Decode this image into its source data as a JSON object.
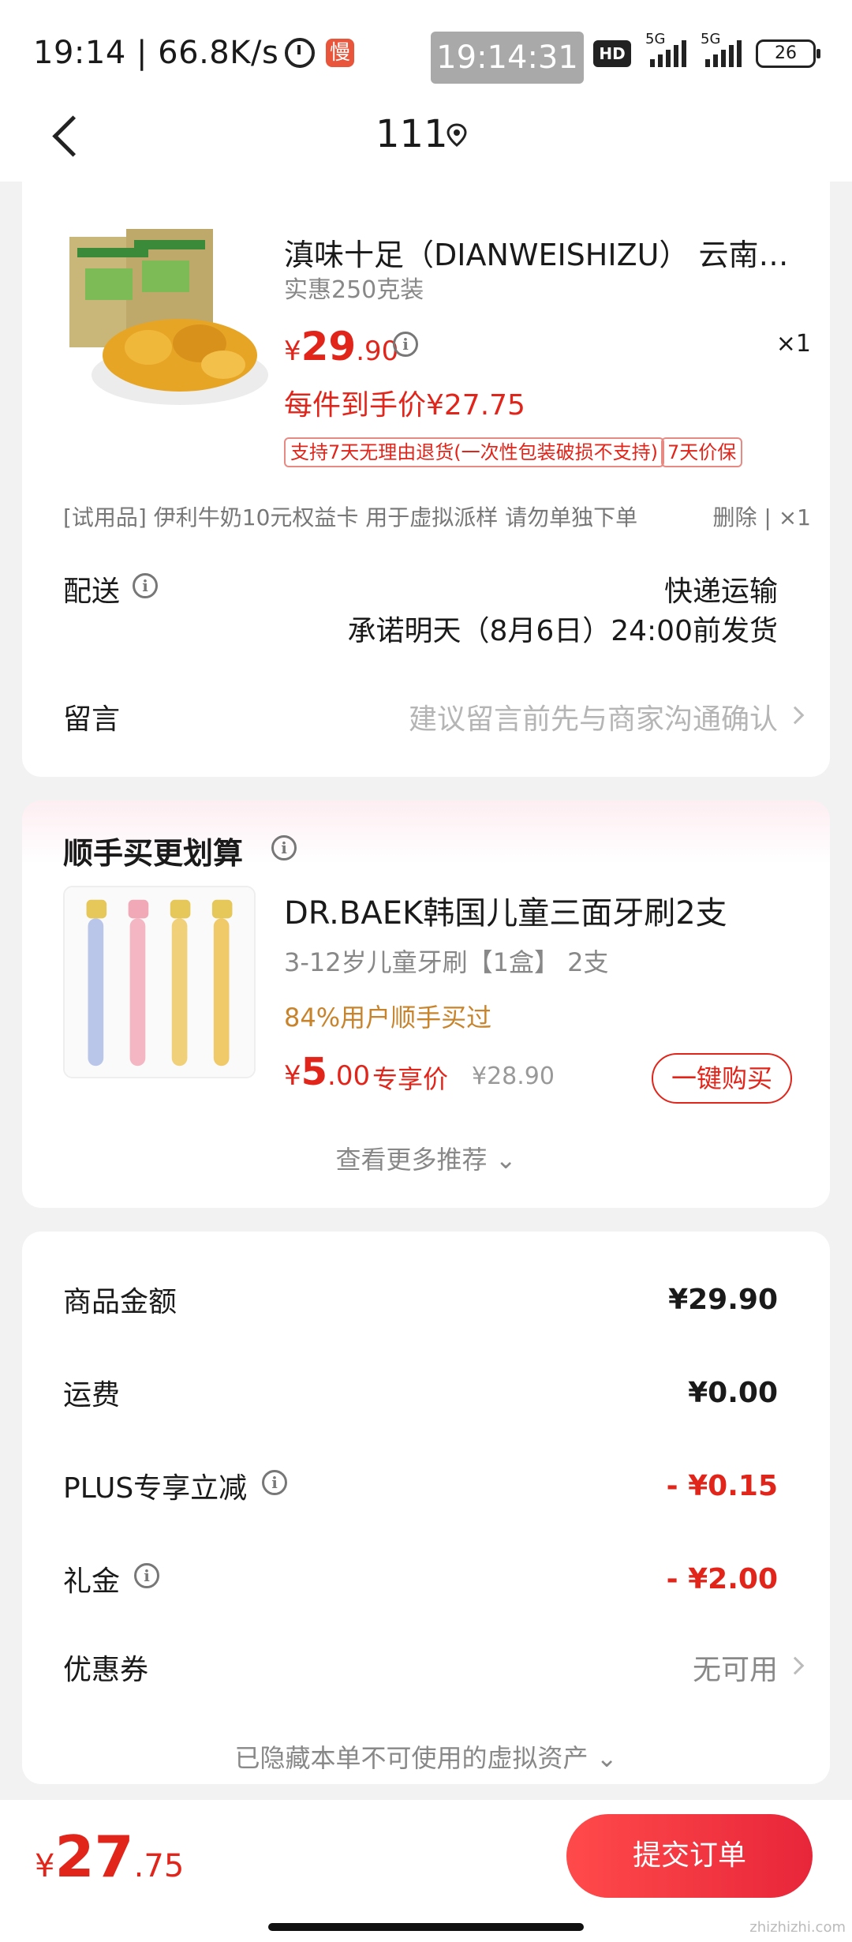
{
  "status_bar": {
    "time_speed": "19:14 | 66.8K/s",
    "slow_badge": "慢",
    "clock": "19:14:31",
    "hd_badge": "HD",
    "signal1_label": "5G",
    "signal2_label": "5G",
    "battery": "26"
  },
  "nav": {
    "title": "111"
  },
  "product": {
    "title": "滇味十足（DIANWEISHIZU） 云南鸡油菌干货",
    "spec": "实惠250克装",
    "price_symbol": "¥",
    "price_int": "29",
    "price_dec": ".90",
    "qty": "×1",
    "arrive_price": "每件到手价¥27.75",
    "tags": [
      "支持7天无理由退货(一次性包装破损不支持)",
      "7天价保"
    ]
  },
  "gift": {
    "text": "[试用品]  伊利牛奶10元权益卡 用于虚拟派样 请勿单独下单",
    "action": "删除 | ×1"
  },
  "delivery": {
    "label": "配送",
    "method": "快递运输",
    "promise": "承诺明天（8月6日）24:00前发货"
  },
  "message": {
    "label": "留言",
    "placeholder": "建议留言前先与商家沟通确认"
  },
  "recommend": {
    "section_title": "顺手买更划算",
    "title": "DR.BAEK韩国儿童三面牙刷2支",
    "sub": "3-12岁儿童牙刷【1盒】 2支",
    "percent": "84%用户顺手买过",
    "price_symbol": "¥",
    "price_int": "5",
    "price_dec": ".00",
    "price_label": "专享价",
    "orig_price": "¥28.90",
    "buy_label": "一键购买",
    "more": "查看更多推荐"
  },
  "summary": {
    "goods_label": "商品金额",
    "goods_value": "¥29.90",
    "freight_label": "运费",
    "freight_value": "¥0.00",
    "plus_label": "PLUS专享立减",
    "plus_value": "- ¥0.15",
    "gift_label": "礼金",
    "gift_value": "- ¥2.00",
    "coupon_label": "优惠券",
    "coupon_value": "无可用",
    "hidden_note": "已隐藏本单不可使用的虚拟资产"
  },
  "bottom": {
    "symbol": "¥",
    "total_int": "27",
    "total_dec": ".75",
    "submit": "提交订单",
    "watermark": "zhizhizhi.com"
  },
  "colors": {
    "accent_red": "#e1251b",
    "orange_text": "#c8842c",
    "background": "#f2f2f2"
  }
}
